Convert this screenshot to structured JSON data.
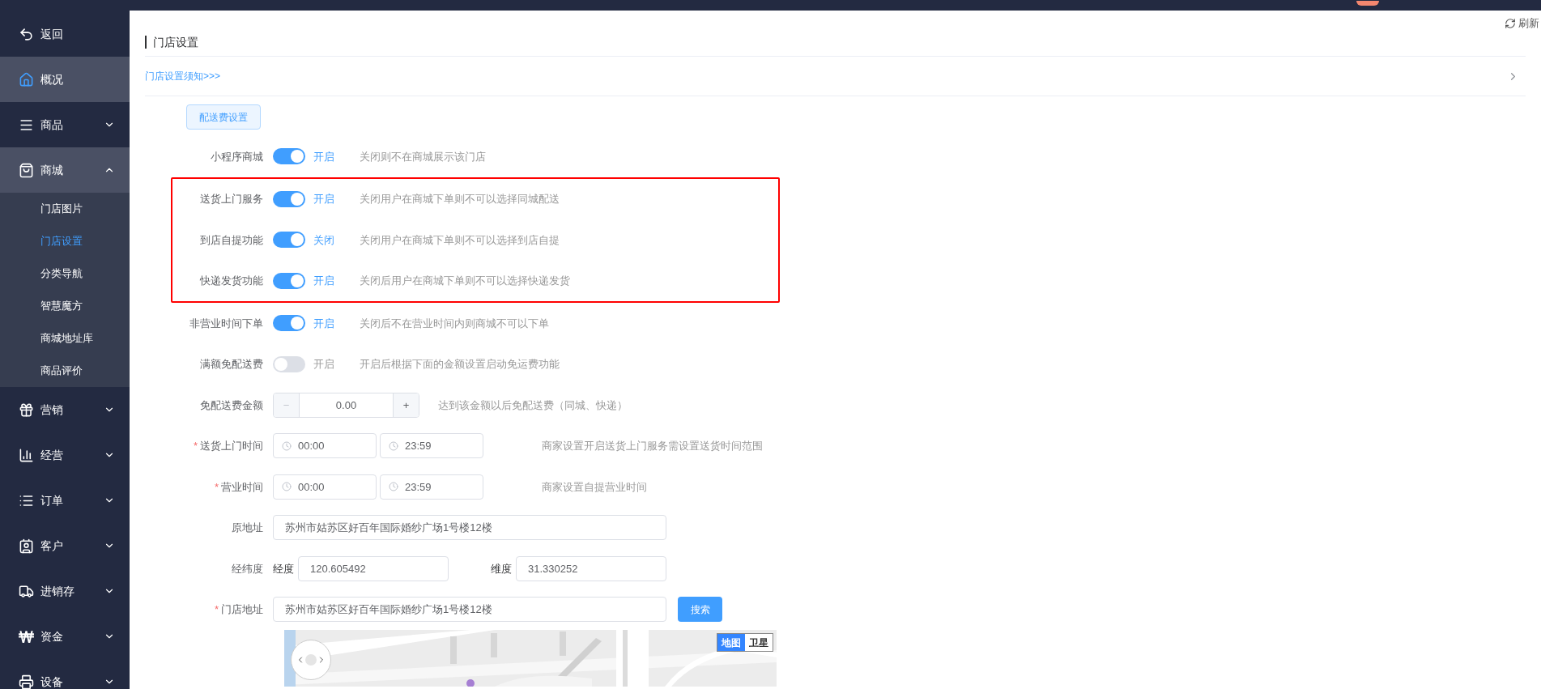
{
  "sidebar": {
    "items": [
      {
        "kind": "link",
        "label": "返回",
        "selected": false
      },
      {
        "kind": "link",
        "label": "概况",
        "selected": true
      },
      {
        "kind": "menu",
        "label": "商品",
        "expanded": false
      },
      {
        "kind": "menu",
        "label": "商城",
        "expanded": true,
        "children": [
          {
            "label": "门店图片",
            "selected": false
          },
          {
            "label": "门店设置",
            "selected": true
          },
          {
            "label": "分类导航",
            "selected": false
          },
          {
            "label": "智慧魔方",
            "selected": false
          },
          {
            "label": "商城地址库",
            "selected": false
          },
          {
            "label": "商品评价",
            "selected": false
          }
        ]
      },
      {
        "kind": "menu",
        "label": "营销",
        "expanded": false
      },
      {
        "kind": "menu",
        "label": "经营",
        "expanded": false
      },
      {
        "kind": "menu",
        "label": "订单",
        "expanded": false
      },
      {
        "kind": "menu",
        "label": "客户",
        "expanded": false
      },
      {
        "kind": "menu",
        "label": "进销存",
        "expanded": false
      },
      {
        "kind": "menu",
        "label": "资金",
        "expanded": false
      },
      {
        "kind": "menu",
        "label": "设备",
        "expanded": false
      }
    ]
  },
  "refresh": "刷新",
  "page": {
    "title": "门店设置",
    "notice_link": "门店设置须知>>>",
    "tab_button": "配送费设置"
  },
  "form": {
    "groups": [
      {
        "highlighted": false,
        "rows": [
          {
            "kind": "toggle",
            "label": "小程序商城",
            "on": true,
            "status": "开启",
            "hint": "关闭则不在商城展示该门店"
          }
        ]
      },
      {
        "highlighted": true,
        "rows": [
          {
            "kind": "toggle",
            "label": "送货上门服务",
            "on": true,
            "status": "开启",
            "hint": "关闭用户在商城下单则不可以选择同城配送"
          },
          {
            "kind": "toggle",
            "label": "到店自提功能",
            "on": true,
            "status": "关闭",
            "hint": "关闭用户在商城下单则不可以选择到店自提"
          },
          {
            "kind": "toggle",
            "label": "快递发货功能",
            "on": true,
            "status": "开启",
            "hint": "关闭后用户在商城下单则不可以选择快递发货"
          }
        ]
      },
      {
        "highlighted": false,
        "rows": [
          {
            "kind": "toggle",
            "label": "非营业时间下单",
            "on": true,
            "status": "开启",
            "hint": "关闭后不在营业时间内则商城不可以下单"
          },
          {
            "kind": "toggle",
            "label": "满额免配送费",
            "on": false,
            "status": "开启",
            "hint": "开启后根据下面的金额设置启动免运费功能"
          },
          {
            "kind": "stepper",
            "label": "免配送费金额",
            "value": "0.00",
            "minus": "−",
            "plus": "+",
            "hint": "达到该金额以后免配送费（同城、快递）"
          },
          {
            "kind": "time_range",
            "label": "送货上门时间",
            "mark": "*",
            "start": "00:00",
            "end": "23:59",
            "hint": "商家设置开启送货上门服务需设置送货时间范围"
          },
          {
            "kind": "time_range",
            "label": "营业时间",
            "mark": "*",
            "start": "00:00",
            "end": "23:59",
            "hint": "商家设置自提营业时间"
          },
          {
            "kind": "text",
            "label": "原地址",
            "value": "苏州市姑苏区好百年国际婚纱广场1号楼12楼"
          },
          {
            "kind": "latlng",
            "label": "经纬度",
            "lng_label": "经度",
            "lng": "120.605492",
            "lat_label": "维度",
            "lat": "31.330252"
          },
          {
            "kind": "address_search",
            "label": "门店地址",
            "mark": "*",
            "value": "苏州市姑苏区好百年国际婚纱广场1号楼12楼",
            "button": "搜索"
          }
        ]
      }
    ]
  },
  "map": {
    "kind": "picture",
    "modes": [
      {
        "label": "地图",
        "selected": true
      },
      {
        "label": "卫星",
        "selected": false
      }
    ]
  }
}
